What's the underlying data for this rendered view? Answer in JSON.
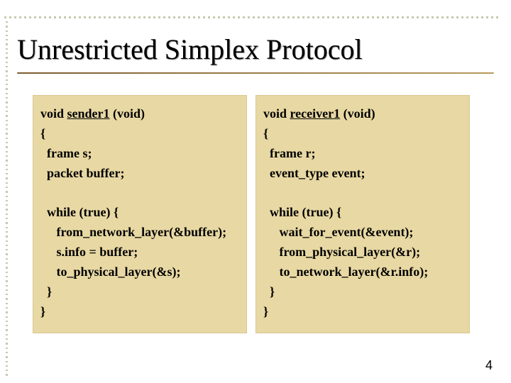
{
  "title": "Unrestricted Simplex Protocol",
  "page_number": "4",
  "left": {
    "sig_pre": "void ",
    "fn_name": "sender1",
    "sig_post": " (void)",
    "l1": "{",
    "l2": "  frame s;",
    "l3": "  packet buffer;",
    "blank1": " ",
    "l4": "  while (true) {",
    "l5": "     from_network_layer(&buffer);",
    "l6": "     s.info = buffer;",
    "l7": "     to_physical_layer(&s);",
    "l8": "  }",
    "l9": "}"
  },
  "right": {
    "sig_pre": "void ",
    "fn_name": "receiver1",
    "sig_post": " (void)",
    "l1": "{",
    "l2": "  frame r;",
    "l3": "  event_type event;",
    "blank1": " ",
    "l4": "  while (true) {",
    "l5": "     wait_for_event(&event);",
    "l6": "     from_physical_layer(&r);",
    "l7": "     to_network_layer(&r.info);",
    "l8": "  }",
    "l9": "}"
  }
}
